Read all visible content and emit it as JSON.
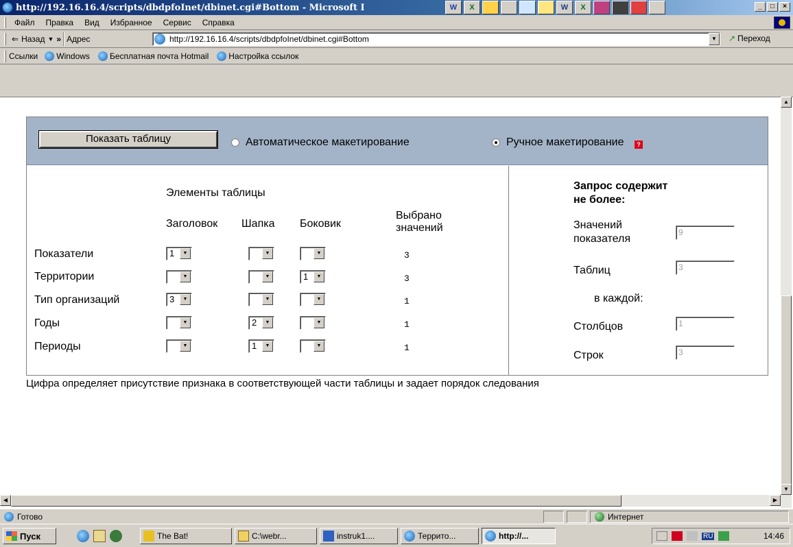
{
  "window": {
    "title": "http://192.16.16.4/scripts/dbdpfoInet/dbinet.cgi#Bottom - Microsoft I",
    "tb_apps": [
      "W",
      "X",
      "",
      "",
      "",
      "",
      "W",
      "X",
      "",
      "",
      "",
      ""
    ],
    "controls": {
      "min": "_",
      "max": "□",
      "close": "×"
    }
  },
  "menu": [
    "Файл",
    "Правка",
    "Вид",
    "Избранное",
    "Сервис",
    "Справка"
  ],
  "nav": {
    "back_label": "Назад",
    "more": "»",
    "address_label": "Адрес",
    "url": "http://192.16.16.4/scripts/dbdpfoInet/dbinet.cgi#Bottom",
    "go_label": "Переход"
  },
  "links": {
    "label": "Ссылки",
    "items": [
      "Windows",
      "Бесплатная почта Hotmail",
      "Настройка ссылок"
    ]
  },
  "page": {
    "show_table_button": "Показать таблицу",
    "radio_auto": "Автоматическое макетирование",
    "radio_manual": "Ручное макетирование",
    "radio_selected": "manual",
    "help_icon": "?",
    "elements_heading": "Элементы таблицы",
    "col_title": "Заголовок",
    "col_head": "Шапка",
    "col_side": "Боковик",
    "col_selected": "Выбрано значений",
    "rows": [
      {
        "label": "Показатели",
        "title": "1",
        "head": "",
        "side": "",
        "selected": "3"
      },
      {
        "label": "Территории",
        "title": "",
        "head": "",
        "side": "1",
        "selected": "3"
      },
      {
        "label": "Тип организаций",
        "title": "3",
        "head": "",
        "side": "",
        "selected": "1"
      },
      {
        "label": "Годы",
        "title": "",
        "head": "2",
        "side": "",
        "selected": "1"
      },
      {
        "label": "Периоды",
        "title": "",
        "head": "1",
        "side": "",
        "selected": "1"
      }
    ],
    "query_heading": "Запрос содержит не более:",
    "values_label": "Значений показателя",
    "values_value": "9",
    "tables_label": "Таблиц",
    "tables_value": "3",
    "each_label": "в каждой:",
    "columns_label": "Столбцов",
    "columns_value": "1",
    "rows_label": "Строк",
    "rows_value": "3",
    "footnote": "Цифра определяет присутствие признака в соответствующей части таблицы и задает порядок следования"
  },
  "status": {
    "left": "Готово",
    "zone": "Интернет"
  },
  "taskbar": {
    "start": "Пуск",
    "tasks": [
      "The Bat!",
      "C:\\webr...",
      "instruk1....",
      "Террито...",
      "http://..."
    ],
    "tray_lang": "RU",
    "clock": "14:46"
  },
  "colors": {
    "title_bar": "#0a246a",
    "panel_header": "#a4b4c8",
    "help_icon": "#e0001a"
  }
}
